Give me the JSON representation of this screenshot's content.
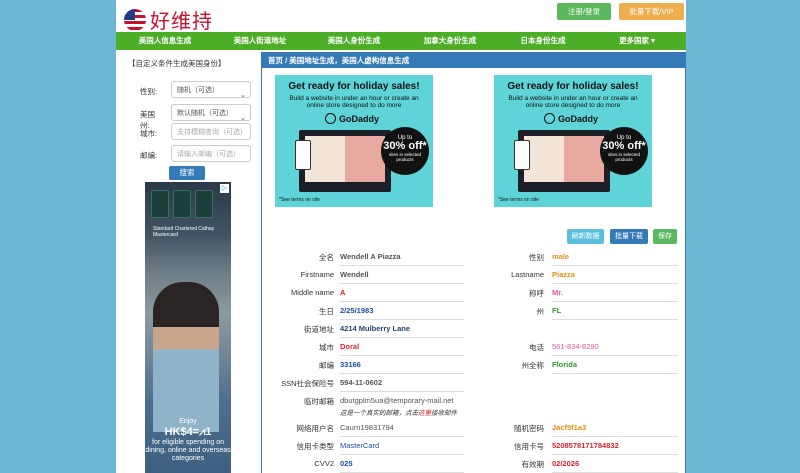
{
  "header": {
    "logo_text": "好维持",
    "login_label": "注册/登录",
    "vip_label": "批量下载/VIP"
  },
  "nav": {
    "items": [
      "美国人信息生成",
      "美国人街道地址",
      "美国人身份生成",
      "加拿大身份生成",
      "日本身份生成",
      "更多国家 ▾"
    ]
  },
  "sidebar": {
    "title": "【自定义条件生成美国身份】",
    "gender_label": "性别:",
    "gender_value": "随机（可选）",
    "state_label": "美国州:",
    "state_value": "默认随机（可选）",
    "city_label": "城市:",
    "city_placeholder": "支持模糊查询（可选）",
    "zip_label": "邮编:",
    "zip_placeholder": "请输入邮编（可选）",
    "search_label": "搜索",
    "ad": {
      "card_label": "Standard Chartered Cathay Mastercard",
      "enjoy": "Enjoy",
      "big": "HK$4=⩘1",
      "body": "for eligible spending on dining, online and overseas categories"
    }
  },
  "main": {
    "breadcrumb": "首页 /  美国地址生成，美国人虚构信息生成",
    "ad": {
      "headline": "Get ready for holiday sales!",
      "sub": "Build a website in under an hour or create an online store designed to do more",
      "brand": "GoDaddy",
      "badge_top": "Up to",
      "badge_big": "30% off*",
      "badge_small": "sites in selected products",
      "terms": "*See terms on site"
    },
    "buttons": {
      "refresh": "刷新数据",
      "batch": "批量下载",
      "save": "保存"
    },
    "rows": [
      {
        "l1": "全名",
        "v1": "Wendell A Piazza",
        "l2": "性别",
        "v2": "male"
      },
      {
        "l1": "Firstname",
        "v1": "Wendell",
        "l2": "Lastname",
        "v2": "Piazza"
      },
      {
        "l1": "Middle name",
        "v1": "A",
        "l2": "称呼",
        "v2": "Mr."
      },
      {
        "l1": "生日",
        "v1": "2/25/1983",
        "l2": "州",
        "v2": "FL"
      },
      {
        "l1": "街道地址",
        "v1": "4214 Mulberry Lane",
        "l2": "",
        "v2": ""
      },
      {
        "l1": "城市",
        "v1": "Doral",
        "l2": "电话",
        "v2": "561-834-8290"
      },
      {
        "l1": "邮编",
        "v1": "33166",
        "l2": "州全称",
        "v2": "Florida"
      },
      {
        "l1": "SSN社会保险号",
        "v1": "594-11-0602",
        "l2": "",
        "v2": ""
      },
      {
        "l1": "临时邮箱",
        "v1": "dbutgplm5ua@temporary-mail.net",
        "l2": "",
        "v2": ""
      },
      {
        "l1": "网络用户名",
        "v1": "Caurn19831794",
        "l2": "随机密码",
        "v2": "Jacf5f1a3"
      },
      {
        "l1": "信用卡类型",
        "v1": "MasterCard",
        "l2": "信用卡号",
        "v2": "5208578171784832"
      },
      {
        "l1": "CVV2",
        "v1": "025",
        "l2": "有效期",
        "v2": "02/2026"
      }
    ],
    "note_pre": "这是一个真实的邮箱，点击",
    "note_link": "这里",
    "note_post": "接收邮件"
  }
}
